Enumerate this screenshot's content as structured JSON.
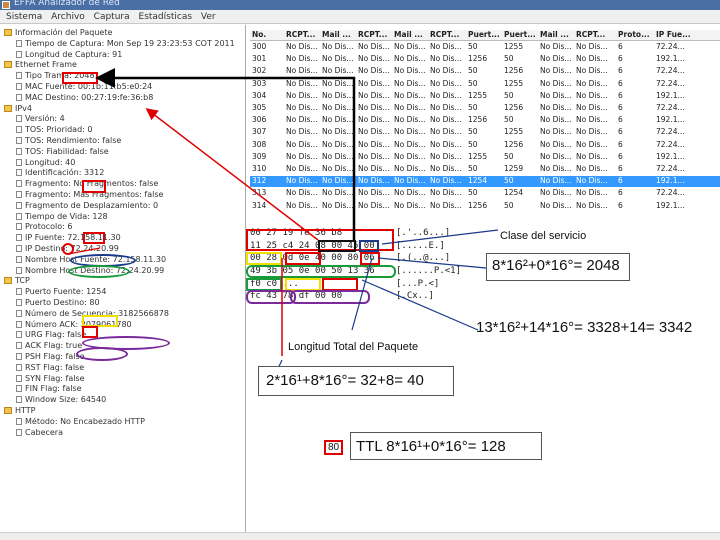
{
  "window": {
    "title": "EFFA Analizador de Red"
  },
  "menu": [
    "Sistema",
    "Archivo",
    "Captura",
    "Estadísticas",
    "Ver"
  ],
  "tree": [
    {
      "label": "Información del Paquete",
      "type": "folder"
    },
    {
      "label": "Tiempo de Captura: Mon Sep 19 23:23:53 COT 2011",
      "type": "leaf"
    },
    {
      "label": "Longitud de Captura: 91",
      "type": "leaf"
    },
    {
      "label": "Ethernet Frame",
      "type": "folder"
    },
    {
      "label": "Tipo Trama: 2048",
      "type": "leaf"
    },
    {
      "label": "MAC Fuente: 00:1b:11:b5:e0:24",
      "type": "leaf"
    },
    {
      "label": "MAC Destino: 00:27:19:fe:36:b8",
      "type": "leaf"
    },
    {
      "label": "IPv4",
      "type": "folder"
    },
    {
      "label": "Versión: 4",
      "type": "leaf"
    },
    {
      "label": "TOS: Prioridad: 0",
      "type": "leaf"
    },
    {
      "label": "TOS: Rendimiento: false",
      "type": "leaf"
    },
    {
      "label": "TOS: Fiabilidad: false",
      "type": "leaf"
    },
    {
      "label": "Longitud: 40",
      "type": "leaf"
    },
    {
      "label": "Identificación: 3312",
      "type": "leaf"
    },
    {
      "label": "Fragmento: No Fragmentos: false",
      "type": "leaf"
    },
    {
      "label": "Fragmento: Más Fragmentos: false",
      "type": "leaf"
    },
    {
      "label": "Fragmento de Desplazamiento: 0",
      "type": "leaf"
    },
    {
      "label": "Tiempo de Vida: 128",
      "type": "leaf"
    },
    {
      "label": "Protocolo: 6",
      "type": "leaf"
    },
    {
      "label": "IP Fuente: 72.158.11.30",
      "type": "leaf"
    },
    {
      "label": "IP Destino: 72.24.20.99",
      "type": "leaf"
    },
    {
      "label": "Nombre Host Fuente: 72.158.11.30",
      "type": "leaf"
    },
    {
      "label": "Nombre Host Destino: 72.24.20.99",
      "type": "leaf"
    },
    {
      "label": "TCP",
      "type": "folder"
    },
    {
      "label": "Puerto Fuente: 1254",
      "type": "leaf"
    },
    {
      "label": "Puerto Destino: 80",
      "type": "leaf"
    },
    {
      "label": "Número de Secuencia: 3182566878",
      "type": "leaf"
    },
    {
      "label": "Número ACK: 2079061780",
      "type": "leaf"
    },
    {
      "label": "URG Flag: false",
      "type": "leaf"
    },
    {
      "label": "ACK Flag: true",
      "type": "leaf"
    },
    {
      "label": "PSH Flag: false",
      "type": "leaf"
    },
    {
      "label": "RST Flag: false",
      "type": "leaf"
    },
    {
      "label": "SYN Flag: false",
      "type": "leaf"
    },
    {
      "label": "FIN Flag: false",
      "type": "leaf"
    },
    {
      "label": "Window Size: 64540",
      "type": "leaf"
    },
    {
      "label": "HTTP",
      "type": "folder"
    },
    {
      "label": "Método: No Encabezado HTTP",
      "type": "leaf"
    },
    {
      "label": "Cabecera",
      "type": "leaf"
    }
  ],
  "table": {
    "columns": [
      "No.",
      "RCPT...",
      "Mail ...",
      "RCPT...",
      "Mail ...",
      "RCPT...",
      "Puert...",
      "Puert...",
      "Mail ...",
      "RCPT...",
      "Proto...",
      "IP Fue..."
    ],
    "rows": [
      [
        "300",
        "No Dis...",
        "No Dis...",
        "No Dis...",
        "No Dis...",
        "No Dis...",
        "50",
        "1255",
        "No Dis...",
        "No Dis...",
        "6",
        "72.24..."
      ],
      [
        "301",
        "No Dis...",
        "No Dis...",
        "No Dis...",
        "No Dis...",
        "No Dis...",
        "1256",
        "50",
        "No Dis...",
        "No Dis...",
        "6",
        "192.1..."
      ],
      [
        "302",
        "No Dis...",
        "No Dis...",
        "No Dis...",
        "No Dis...",
        "No Dis...",
        "50",
        "1256",
        "No Dis...",
        "No Dis...",
        "6",
        "72.24..."
      ],
      [
        "303",
        "No Dis...",
        "No Dis...",
        "No Dis...",
        "No Dis...",
        "No Dis...",
        "50",
        "1255",
        "No Dis...",
        "No Dis...",
        "6",
        "72.24..."
      ],
      [
        "304",
        "No Dis...",
        "No Dis...",
        "No Dis...",
        "No Dis...",
        "No Dis...",
        "1255",
        "50",
        "No Dis...",
        "No Dis...",
        "6",
        "192.1..."
      ],
      [
        "305",
        "No Dis...",
        "No Dis...",
        "No Dis...",
        "No Dis...",
        "No Dis...",
        "50",
        "1256",
        "No Dis...",
        "No Dis...",
        "6",
        "72.24..."
      ],
      [
        "306",
        "No Dis...",
        "No Dis...",
        "No Dis...",
        "No Dis...",
        "No Dis...",
        "1256",
        "50",
        "No Dis...",
        "No Dis...",
        "6",
        "192.1..."
      ],
      [
        "307",
        "No Dis...",
        "No Dis...",
        "No Dis...",
        "No Dis...",
        "No Dis...",
        "50",
        "1255",
        "No Dis...",
        "No Dis...",
        "6",
        "72.24..."
      ],
      [
        "308",
        "No Dis...",
        "No Dis...",
        "No Dis...",
        "No Dis...",
        "No Dis...",
        "50",
        "1256",
        "No Dis...",
        "No Dis...",
        "6",
        "72.24..."
      ],
      [
        "309",
        "No Dis...",
        "No Dis...",
        "No Dis...",
        "No Dis...",
        "No Dis...",
        "1255",
        "50",
        "No Dis...",
        "No Dis...",
        "6",
        "192.1..."
      ],
      [
        "310",
        "No Dis...",
        "No Dis...",
        "No Dis...",
        "No Dis...",
        "No Dis...",
        "50",
        "1259",
        "No Dis...",
        "No Dis...",
        "6",
        "72.24..."
      ],
      [
        "312",
        "No Dis...",
        "No Dis...",
        "No Dis...",
        "No Dis...",
        "No Dis...",
        "1254",
        "50",
        "No Dis...",
        "No Dis...",
        "6",
        "192.1..."
      ],
      [
        "313",
        "No Dis...",
        "No Dis...",
        "No Dis...",
        "No Dis...",
        "No Dis...",
        "50",
        "1254",
        "No Dis...",
        "No Dis...",
        "6",
        "72.24..."
      ],
      [
        "314",
        "No Dis...",
        "No Dis...",
        "No Dis...",
        "No Dis...",
        "No Dis...",
        "1256",
        "50",
        "No Dis...",
        "No Dis...",
        "6",
        "192.1..."
      ]
    ],
    "selected_row_label": "312"
  },
  "hex": {
    "lines": [
      "00 27 19 fe 36 b8",
      "11 25 c4 24 08 00 45 00",
      "00 28 0d 0e 40 00 80 06",
      "49 3b 05 0e 00 50 13 36",
      "f0 c0 ...",
      "fc 43 78 df 00 00"
    ],
    "ascii": [
      "[.'..6...]",
      "[.....E.]",
      "[.(..@...]",
      "[......P.<1]",
      "[...P.<]",
      "[.Cx..]"
    ]
  },
  "annotations": {
    "clase_servicio": "Clase del servicio",
    "tipo_trama_calc": "8*16²+0*16°= 2048",
    "identificacion_calc": "13*16²+14*16°= 3328+14= 3342",
    "longitud_total": "Longitud Total del Paquete",
    "longitud_calc": "2*16¹+8*16°= 32+8= 40",
    "ttl_calc": "TTL 8*16¹+0*16°= 128",
    "ttl_hex": "80"
  },
  "colors": {
    "red": "#e00000",
    "blue": "#1a3a8a",
    "green": "#1a9a3a",
    "purple": "#7a2a9a",
    "yellow": "#f0e000",
    "black": "#000000",
    "selected": "#3399ff"
  }
}
